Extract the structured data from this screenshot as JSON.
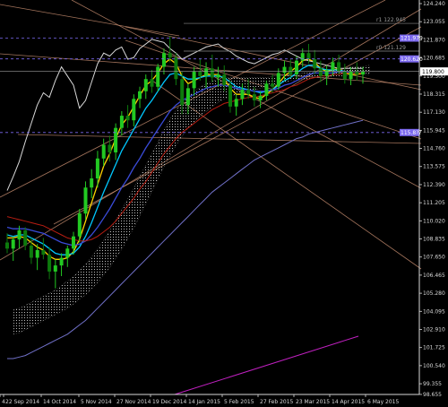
{
  "chart_data": {
    "type": "candlestick",
    "title": "",
    "xlabel": "",
    "ylabel": "",
    "ylim": [
      98.655,
      124.24
    ],
    "grid": false,
    "x_tick_labels": [
      "4",
      "22 Sep 2014",
      "14 Oct 2014",
      "5 Nov 2014",
      "27 Nov 2014",
      "19 Dec 2014",
      "14 Jan 2015",
      "5 Feb 2015",
      "27 Feb 2015",
      "23 Mar 2015",
      "14 Apr 2015",
      "6 May 2015"
    ],
    "y_tick_labels": [
      "124.240",
      "123.055",
      "121.870",
      "120.685",
      "119.500",
      "118.315",
      "117.130",
      "115.945",
      "114.760",
      "113.575",
      "112.390",
      "111.205",
      "110.020",
      "108.835",
      "107.650",
      "106.465",
      "105.280",
      "104.095",
      "102.910",
      "101.725",
      "100.540",
      "99.355",
      "98.655"
    ],
    "y_tick_values": [
      124.24,
      123.055,
      121.87,
      120.685,
      119.5,
      118.315,
      117.13,
      115.945,
      114.76,
      113.575,
      112.39,
      111.205,
      110.02,
      108.835,
      107.65,
      106.465,
      105.28,
      104.095,
      102.91,
      101.725,
      100.54,
      99.355,
      98.655
    ],
    "current_price": 119.8,
    "current_price_label": "119.800",
    "horizontal_levels": [
      {
        "value": 121.979,
        "label": "121.979",
        "color": "#7b68ee",
        "style": "dashed"
      },
      {
        "value": 120.62,
        "label": "120.620",
        "color": "#7b68ee",
        "style": "dashed"
      },
      {
        "value": 115.8,
        "label": "115.8??",
        "color": "#7b68ee",
        "style": "dashed"
      }
    ],
    "fib_levels": [
      {
        "value": 122.945,
        "label": "r1 122.945"
      },
      {
        "value": 121.129,
        "label": "r0 121.129"
      }
    ],
    "series": [
      {
        "kind": "candles",
        "values": [
          [
            108.6,
            109.2,
            107.9,
            108.2
          ],
          [
            108.2,
            109.0,
            107.4,
            108.8
          ],
          [
            108.8,
            109.7,
            108.2,
            109.4
          ],
          [
            109.4,
            109.6,
            108.1,
            108.4
          ],
          [
            108.4,
            108.9,
            107.2,
            107.6
          ],
          [
            107.6,
            108.5,
            106.8,
            108.1
          ],
          [
            108.1,
            108.9,
            107.5,
            107.8
          ],
          [
            107.8,
            108.3,
            106.2,
            106.7
          ],
          [
            106.7,
            107.5,
            105.6,
            107.1
          ],
          [
            107.1,
            107.9,
            106.4,
            107.6
          ],
          [
            107.6,
            108.4,
            107.0,
            108.2
          ],
          [
            108.2,
            109.3,
            107.8,
            109.0
          ],
          [
            109.0,
            110.8,
            108.6,
            110.5
          ],
          [
            110.5,
            112.6,
            110.1,
            112.2
          ],
          [
            112.2,
            113.4,
            111.5,
            112.8
          ],
          [
            112.8,
            114.6,
            112.2,
            114.1
          ],
          [
            114.1,
            115.4,
            113.6,
            115.0
          ],
          [
            115.0,
            115.6,
            113.9,
            114.5
          ],
          [
            114.5,
            116.4,
            114.0,
            116.1
          ],
          [
            116.1,
            117.2,
            115.6,
            116.9
          ],
          [
            116.9,
            117.6,
            116.1,
            116.6
          ],
          [
            116.6,
            118.3,
            116.2,
            118.0
          ],
          [
            118.0,
            118.8,
            117.4,
            118.5
          ],
          [
            118.5,
            119.6,
            118.0,
            119.3
          ],
          [
            119.3,
            119.9,
            118.4,
            118.8
          ],
          [
            118.8,
            120.3,
            118.5,
            120.1
          ],
          [
            120.1,
            121.3,
            119.6,
            121.0
          ],
          [
            121.0,
            122.1,
            120.4,
            120.7
          ],
          [
            120.7,
            121.0,
            118.9,
            119.3
          ],
          [
            119.3,
            119.8,
            117.0,
            117.6
          ],
          [
            117.6,
            119.0,
            117.0,
            118.7
          ],
          [
            118.7,
            120.1,
            118.2,
            119.8
          ],
          [
            119.8,
            120.6,
            119.2,
            119.5
          ],
          [
            119.5,
            120.4,
            118.7,
            120.0
          ],
          [
            120.0,
            120.9,
            119.1,
            119.4
          ],
          [
            119.4,
            120.1,
            118.8,
            119.6
          ],
          [
            119.6,
            120.2,
            118.5,
            118.9
          ],
          [
            118.9,
            119.2,
            117.1,
            117.5
          ],
          [
            117.5,
            118.3,
            116.9,
            118.0
          ],
          [
            118.0,
            119.0,
            117.6,
            118.6
          ],
          [
            118.6,
            119.3,
            118.0,
            118.3
          ],
          [
            118.3,
            118.8,
            117.5,
            117.9
          ],
          [
            117.9,
            118.5,
            117.4,
            118.2
          ],
          [
            118.2,
            119.2,
            117.9,
            119.0
          ],
          [
            119.0,
            119.6,
            118.4,
            118.8
          ],
          [
            118.8,
            120.0,
            118.6,
            119.7
          ],
          [
            119.7,
            120.5,
            119.2,
            120.1
          ],
          [
            120.1,
            120.6,
            119.4,
            119.6
          ],
          [
            119.6,
            120.8,
            119.3,
            120.5
          ],
          [
            120.5,
            121.3,
            120.1,
            121.0
          ],
          [
            121.0,
            121.6,
            120.3,
            120.6
          ],
          [
            120.6,
            121.2,
            119.6,
            120.0
          ],
          [
            120.0,
            120.5,
            119.1,
            119.5
          ],
          [
            119.5,
            120.2,
            118.9,
            119.9
          ],
          [
            119.9,
            120.7,
            119.5,
            120.4
          ],
          [
            120.4,
            120.9,
            119.6,
            119.8
          ],
          [
            119.8,
            120.3,
            119.0,
            119.3
          ],
          [
            119.3,
            120.1,
            118.9,
            119.8
          ],
          [
            119.8,
            120.4,
            119.2,
            119.6
          ],
          [
            119.6,
            120.1,
            119.0,
            119.8
          ]
        ]
      },
      {
        "kind": "line",
        "name": "",
        "color": "#ffd400",
        "values": [
          108.9,
          108.9,
          109.0,
          108.9,
          108.6,
          108.3,
          108.1,
          107.7,
          107.5,
          107.5,
          107.6,
          108.0,
          108.8,
          110.0,
          111.2,
          112.4,
          113.6,
          114.4,
          115.4,
          116.3,
          116.8,
          117.5,
          118.2,
          118.9,
          119.2,
          119.7,
          120.3,
          120.6,
          120.3,
          119.5,
          119.0,
          119.2,
          119.4,
          119.6,
          119.6,
          119.6,
          119.3,
          118.7,
          118.3,
          118.3,
          118.3,
          118.1,
          118.0,
          118.3,
          118.6,
          119.0,
          119.5,
          119.8,
          120.1,
          120.5,
          120.6,
          120.4,
          120.0,
          119.8,
          119.9,
          120.0,
          119.7,
          119.6,
          119.6,
          119.7
        ]
      },
      {
        "kind": "line",
        "name": "",
        "color": "#00c8ff",
        "values": [
          109.1,
          109.0,
          109.1,
          109.1,
          108.9,
          108.7,
          108.5,
          108.2,
          107.9,
          107.8,
          107.8,
          107.9,
          108.3,
          109.0,
          109.9,
          110.9,
          111.9,
          112.8,
          113.7,
          114.6,
          115.3,
          116.0,
          116.7,
          117.4,
          117.9,
          118.5,
          119.1,
          119.6,
          119.7,
          119.5,
          119.3,
          119.3,
          119.4,
          119.5,
          119.5,
          119.5,
          119.4,
          119.1,
          118.8,
          118.7,
          118.6,
          118.5,
          118.4,
          118.5,
          118.6,
          118.9,
          119.2,
          119.4,
          119.7,
          120.0,
          120.2,
          120.2,
          120.0,
          119.9,
          119.9,
          119.9,
          119.8,
          119.7,
          119.7,
          119.7
        ]
      },
      {
        "kind": "line",
        "name": "",
        "color": "#3a4bd8",
        "values": [
          109.6,
          109.5,
          109.5,
          109.5,
          109.4,
          109.3,
          109.2,
          109.0,
          108.8,
          108.6,
          108.5,
          108.4,
          108.5,
          108.7,
          109.1,
          109.6,
          110.2,
          110.8,
          111.5,
          112.2,
          112.8,
          113.5,
          114.1,
          114.8,
          115.4,
          116.0,
          116.6,
          117.2,
          117.6,
          117.9,
          118.1,
          118.3,
          118.5,
          118.7,
          118.8,
          118.9,
          118.9,
          118.8,
          118.7,
          118.6,
          118.6,
          118.5,
          118.5,
          118.5,
          118.6,
          118.7,
          118.9,
          119.0,
          119.2,
          119.4,
          119.6,
          119.7,
          119.7,
          119.7,
          119.7,
          119.8,
          119.8,
          119.7,
          119.7,
          119.7
        ]
      },
      {
        "kind": "line",
        "name": "",
        "color": "#b81d12",
        "values": [
          110.3,
          110.2,
          110.1,
          110.0,
          109.9,
          109.8,
          109.7,
          109.5,
          109.3,
          109.1,
          108.9,
          108.8,
          108.7,
          108.7,
          108.8,
          109.0,
          109.3,
          109.6,
          110.0,
          110.5,
          111.0,
          111.5,
          112.1,
          112.6,
          113.2,
          113.8,
          114.4,
          114.9,
          115.4,
          115.8,
          116.1,
          116.4,
          116.7,
          117.0,
          117.3,
          117.5,
          117.7,
          117.8,
          117.9,
          118.0,
          118.1,
          118.1,
          118.2,
          118.3,
          118.4,
          118.5,
          118.6,
          118.8,
          118.9,
          119.1,
          119.3,
          119.4,
          119.5,
          119.5,
          119.6,
          119.6,
          119.7,
          119.7,
          119.7,
          119.7
        ]
      },
      {
        "kind": "line",
        "name": "",
        "color": "#7070c8",
        "values": [
          101.0,
          101.0,
          101.1,
          101.2,
          101.4,
          101.6,
          101.8,
          102.0,
          102.2,
          102.4,
          102.6,
          102.9,
          103.2,
          103.5,
          103.9,
          104.3,
          104.7,
          105.1,
          105.5,
          105.9,
          106.3,
          106.7,
          107.1,
          107.5,
          107.9,
          108.3,
          108.7,
          109.1,
          109.5,
          109.9,
          110.3,
          110.7,
          111.1,
          111.5,
          111.9,
          112.2,
          112.5,
          112.8,
          113.1,
          113.4,
          113.7,
          114.0,
          114.2,
          114.4,
          114.6,
          114.8,
          115.0,
          115.2,
          115.4,
          115.5,
          115.7,
          115.8,
          115.9,
          116.0,
          116.1,
          116.2,
          116.3,
          116.4,
          116.5,
          116.6
        ]
      },
      {
        "kind": "line",
        "name": "",
        "color": "#d8d8d8",
        "values": [
          112.0,
          112.9,
          113.9,
          115.2,
          116.4,
          117.6,
          118.4,
          118.1,
          119.2,
          120.1,
          119.5,
          118.9,
          117.4,
          117.9,
          119.1,
          120.3,
          121.0,
          120.8,
          121.2,
          121.4,
          120.6,
          120.7,
          121.3,
          121.6,
          121.9,
          121.8,
          121.7,
          121.3,
          121.0,
          120.6,
          120.8,
          121.0,
          121.2,
          121.4,
          121.5,
          121.6,
          121.3,
          121.1,
          120.8,
          120.6,
          120.4,
          120.3,
          120.5,
          120.7,
          120.9,
          121.0,
          121.2,
          121.0,
          120.8,
          120.6,
          120.5,
          120.4,
          120.3,
          120.2,
          120.1,
          120.0,
          120.0,
          120.0,
          120.0,
          120.0
        ]
      }
    ],
    "kumo": {
      "upper": [
        104.2,
        104.3,
        104.5,
        104.7,
        104.9,
        105.1,
        105.3,
        105.5,
        105.8,
        106.1,
        106.4,
        106.8,
        107.2,
        107.7,
        108.2,
        108.8,
        109.4,
        110.1,
        110.8,
        111.5,
        112.2,
        113.0,
        113.7,
        114.5,
        115.2,
        116.0,
        116.7,
        117.3,
        117.8,
        118.2,
        118.5,
        118.8,
        119.0,
        119.2,
        119.3,
        119.4,
        119.4,
        119.4,
        119.4,
        119.4,
        119.4,
        119.4,
        119.4,
        119.5,
        119.5,
        119.5,
        119.6,
        119.6,
        119.7,
        119.7,
        119.8,
        119.8,
        119.9,
        119.9,
        120.0,
        120.0,
        120.1,
        120.1,
        120.1,
        120.2
      ],
      "lower": [
        102.6,
        102.7,
        102.9,
        103.1,
        103.3,
        103.5,
        103.7,
        103.9,
        104.1,
        104.3,
        104.6,
        104.9,
        105.2,
        105.6,
        106.0,
        106.5,
        107.0,
        107.6,
        108.2,
        108.9,
        109.6,
        110.4,
        111.2,
        112.0,
        112.8,
        113.6,
        114.3,
        115.0,
        115.6,
        116.1,
        116.5,
        116.9,
        117.2,
        117.5,
        117.8,
        118.0,
        118.2,
        118.3,
        118.4,
        118.5,
        118.6,
        118.7,
        118.8,
        118.9,
        119.0,
        119.1,
        119.2,
        119.2,
        119.3,
        119.3,
        119.4,
        119.4,
        119.4,
        119.5,
        119.5,
        119.5,
        119.6,
        119.6,
        119.6,
        119.6
      ]
    },
    "colors": {
      "bull": "#22c922",
      "bear": "#0d7a0d",
      "axis": "#d8d8d8",
      "trend": "#d99a7a",
      "magenta": "#c020c0"
    }
  }
}
